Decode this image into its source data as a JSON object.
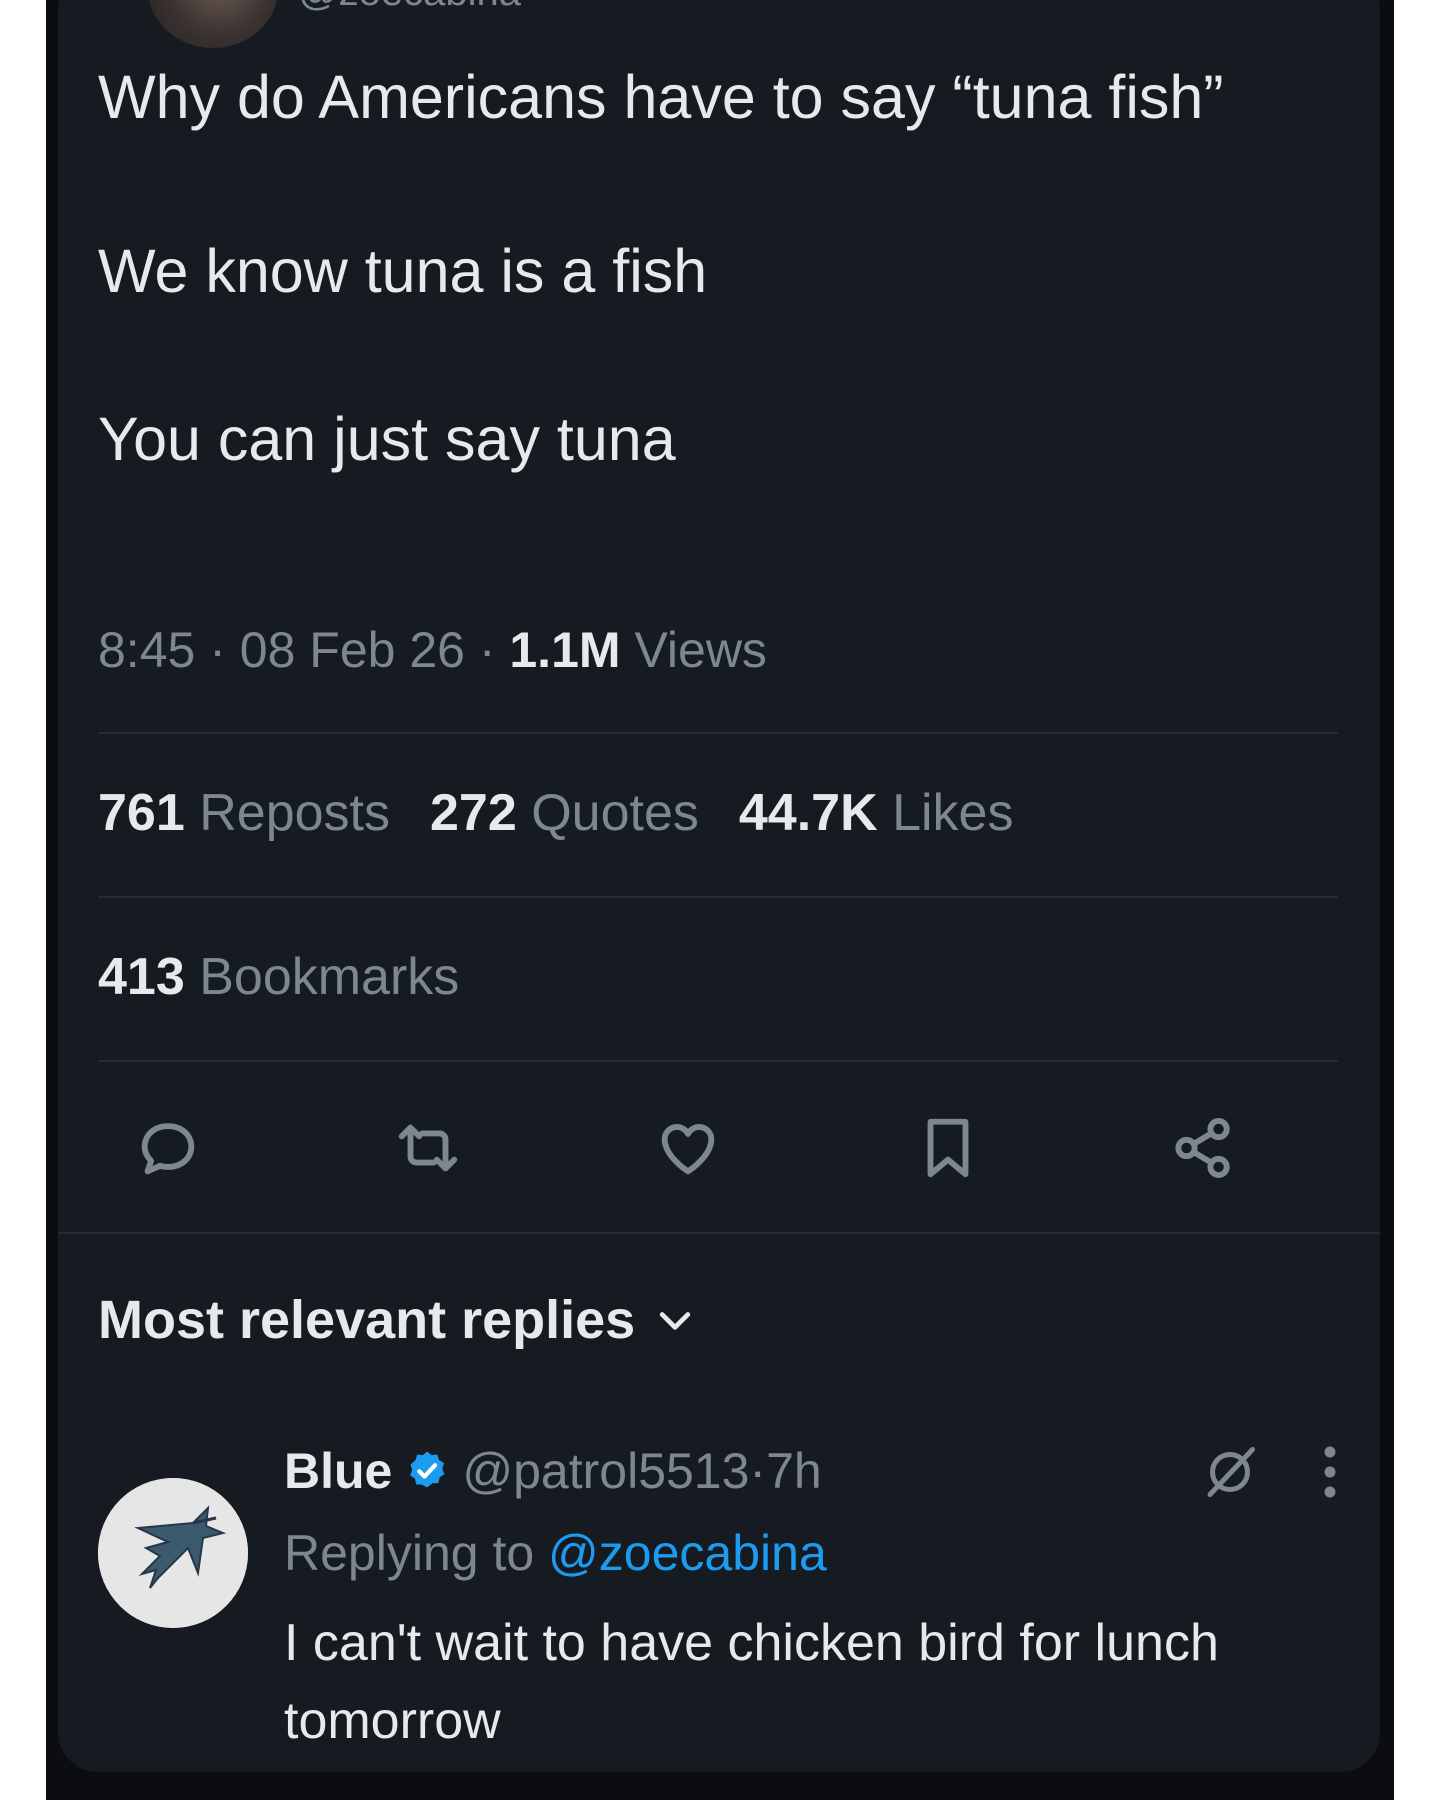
{
  "author": {
    "handle": "@zoecabina"
  },
  "tweet": {
    "paragraphs": [
      "Why do Americans have to say “tuna fish”",
      "We know tuna is a fish",
      "You can just say tuna"
    ],
    "time": "8:45",
    "date": "08 Feb 26",
    "views_count": "1.1M",
    "views_label": "Views",
    "separator": " · "
  },
  "stats": {
    "reposts_count": "761",
    "reposts_label": "Reposts",
    "quotes_count": "272",
    "quotes_label": "Quotes",
    "likes_count": "44.7K",
    "likes_label": "Likes",
    "bookmarks_count": "413",
    "bookmarks_label": "Bookmarks"
  },
  "actions": {
    "icons": [
      "reply-icon",
      "repost-icon",
      "like-icon",
      "bookmark-icon",
      "share-icon"
    ],
    "icon_color": "#7d8792"
  },
  "replies": {
    "header": "Most relevant replies",
    "items": [
      {
        "name": "Blue",
        "handle": "@patrol5513",
        "age": "7h",
        "replying_prefix": "Replying to ",
        "replying_to": "@zoecabina",
        "text": "I can't wait to have chicken bird for lunch tomorrow"
      }
    ]
  },
  "colors": {
    "background": "#161b22",
    "text": "#e7e9ea",
    "muted": "#7d8792",
    "accent": "#1d9bf0",
    "divider": "#262c35"
  }
}
